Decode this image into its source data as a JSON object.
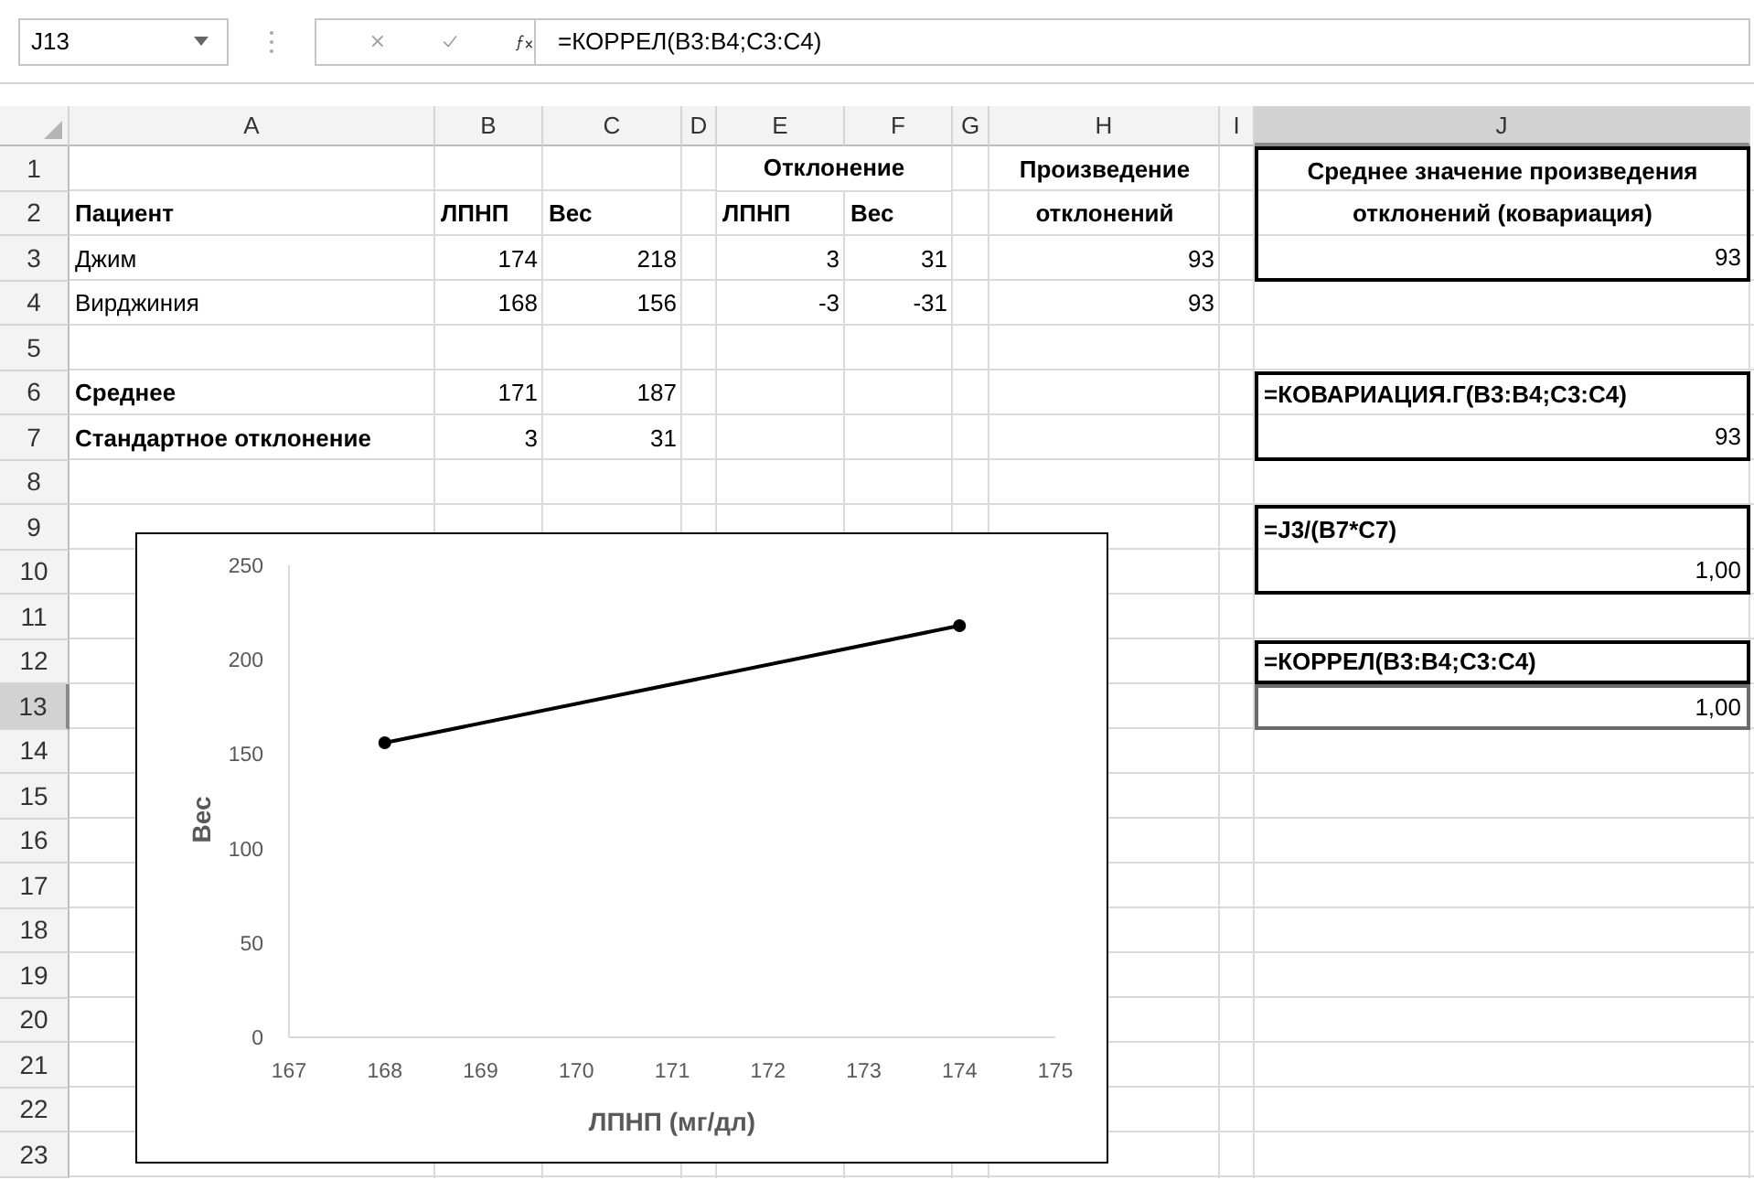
{
  "formula_bar": {
    "name_box": "J13",
    "formula": "=КОРРЕЛ(B3:B4;C3:C4)"
  },
  "columns": [
    {
      "label": "A",
      "selected": false
    },
    {
      "label": "B",
      "selected": false
    },
    {
      "label": "C",
      "selected": false
    },
    {
      "label": "D",
      "selected": false
    },
    {
      "label": "E",
      "selected": false
    },
    {
      "label": "F",
      "selected": false
    },
    {
      "label": "G",
      "selected": false
    },
    {
      "label": "H",
      "selected": false
    },
    {
      "label": "I",
      "selected": false
    },
    {
      "label": "J",
      "selected": true
    }
  ],
  "rows": [
    {
      "number": "1",
      "selected": false,
      "cells": {
        "E": {
          "text": "Отклонение",
          "bold": true,
          "selected": false
        },
        "H": {
          "text": "Произведение",
          "bold": true,
          "selected": false
        },
        "J": {
          "text": "Среднее значение произведения",
          "bold": true,
          "selected": false
        }
      }
    },
    {
      "number": "2",
      "selected": false,
      "cells": {
        "A": {
          "text": "Пациент",
          "bold": true,
          "selected": false
        },
        "B": {
          "text": "ЛПНП",
          "bold": true,
          "selected": false
        },
        "C": {
          "text": "Вес",
          "bold": true,
          "selected": false
        },
        "E": {
          "text": "ЛПНП",
          "bold": true,
          "selected": false
        },
        "F": {
          "text": "Вес",
          "bold": true,
          "selected": false
        },
        "H": {
          "text": "отклонений",
          "bold": true,
          "selected": false
        },
        "J": {
          "text": "отклонений (ковариация)",
          "bold": true,
          "selected": false
        }
      }
    },
    {
      "number": "3",
      "selected": false,
      "cells": {
        "A": {
          "text": "Джим",
          "bold": false,
          "selected": false
        },
        "B": {
          "text": "174",
          "bold": false,
          "selected": false
        },
        "C": {
          "text": "218",
          "bold": false,
          "selected": false
        },
        "E": {
          "text": "3",
          "bold": false,
          "selected": false
        },
        "F": {
          "text": "31",
          "bold": false,
          "selected": false
        },
        "H": {
          "text": "93",
          "bold": false,
          "selected": false
        },
        "J": {
          "text": "93",
          "bold": false,
          "selected": false
        }
      }
    },
    {
      "number": "4",
      "selected": false,
      "cells": {
        "A": {
          "text": "Вирджиния",
          "bold": false,
          "selected": false
        },
        "B": {
          "text": "168",
          "bold": false,
          "selected": false
        },
        "C": {
          "text": "156",
          "bold": false,
          "selected": false
        },
        "E": {
          "text": "-3",
          "bold": false,
          "selected": false
        },
        "F": {
          "text": "-31",
          "bold": false,
          "selected": false
        },
        "H": {
          "text": "93",
          "bold": false,
          "selected": false
        }
      }
    },
    {
      "number": "5",
      "selected": false
    },
    {
      "number": "6",
      "selected": false,
      "cells": {
        "A": {
          "text": "Среднее",
          "bold": true,
          "selected": false
        },
        "B": {
          "text": "171",
          "bold": false,
          "selected": false
        },
        "C": {
          "text": "187",
          "bold": false,
          "selected": false
        },
        "J": {
          "text": "=КОВАРИАЦИЯ.Г(B3:B4;C3:C4)",
          "bold": true,
          "selected": false
        }
      }
    },
    {
      "number": "7",
      "selected": false,
      "cells": {
        "A": {
          "text": "Стандартное отклонение",
          "bold": true,
          "selected": false
        },
        "B": {
          "text": "3",
          "bold": false,
          "selected": false
        },
        "C": {
          "text": "31",
          "bold": false,
          "selected": false
        },
        "J": {
          "text": "93",
          "bold": false,
          "selected": false
        }
      }
    },
    {
      "number": "8",
      "selected": false
    },
    {
      "number": "9",
      "selected": false,
      "cells": {
        "J": {
          "text": "=J3/(B7*C7)",
          "bold": true,
          "selected": false
        }
      }
    },
    {
      "number": "10",
      "selected": false,
      "cells": {
        "J": {
          "text": "1,00",
          "bold": false,
          "selected": false
        }
      }
    },
    {
      "number": "11",
      "selected": false
    },
    {
      "number": "12",
      "selected": false,
      "cells": {
        "J": {
          "text": "=КОРРЕЛ(B3:B4;C3:C4)",
          "bold": true,
          "selected": false
        }
      }
    },
    {
      "number": "13",
      "selected": true,
      "cells": {
        "J": {
          "text": "1,00",
          "bold": false,
          "selected": true
        }
      }
    },
    {
      "number": "14",
      "selected": false
    },
    {
      "number": "15",
      "selected": false
    },
    {
      "number": "16",
      "selected": false
    },
    {
      "number": "17",
      "selected": false
    },
    {
      "number": "18",
      "selected": false
    },
    {
      "number": "19",
      "selected": false
    },
    {
      "number": "20",
      "selected": false
    },
    {
      "number": "21",
      "selected": false
    },
    {
      "number": "22",
      "selected": false
    },
    {
      "number": "23",
      "selected": false
    }
  ],
  "chart": {
    "chart_data": {
      "type": "line",
      "xlabel": "ЛПНП (мг/дл)",
      "ylabel": "Вес",
      "x": [
        168,
        174
      ],
      "series": [
        {
          "color": "#000000",
          "marker": "circle",
          "values": [
            156,
            218
          ]
        }
      ],
      "xlim": [
        167,
        175
      ],
      "ylim": [
        0,
        250
      ],
      "xticks": [
        167,
        168,
        169,
        170,
        171,
        172,
        173,
        174,
        175
      ],
      "yticks": [
        0,
        50,
        100,
        150,
        200,
        250
      ]
    }
  }
}
